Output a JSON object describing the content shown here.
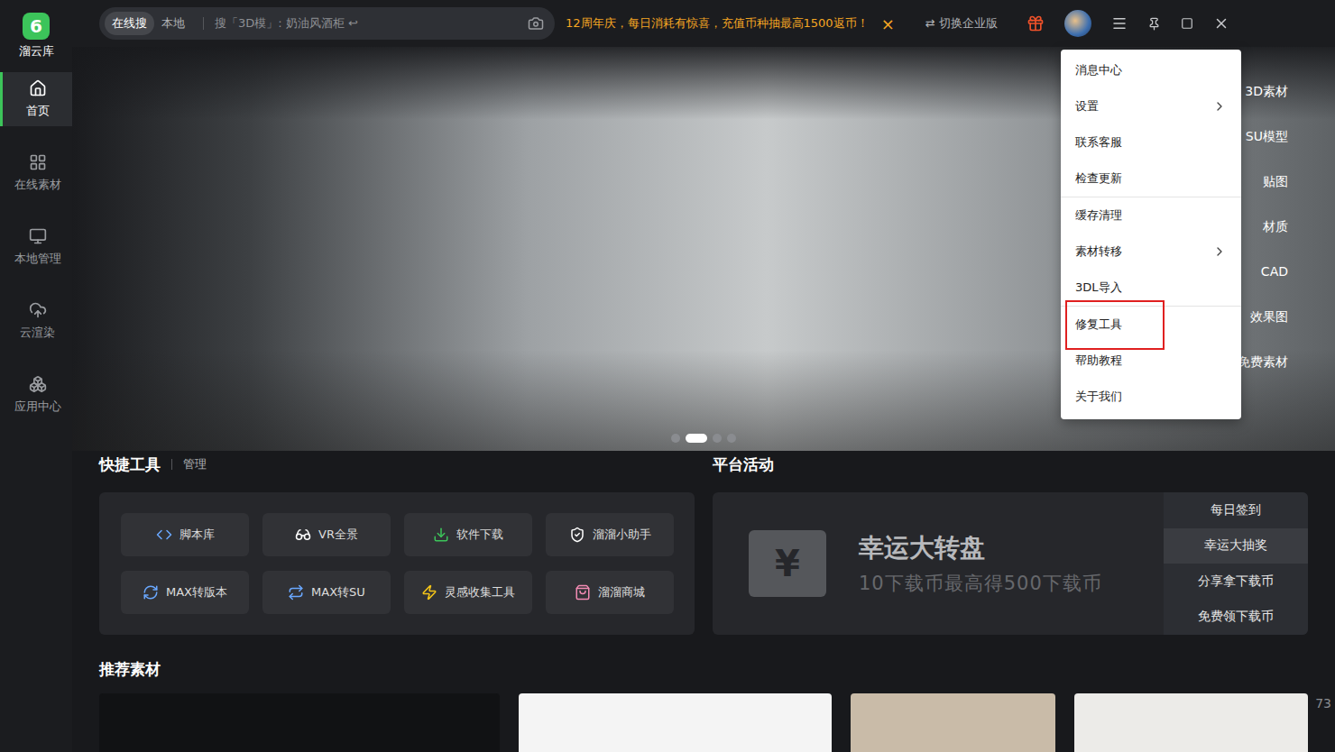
{
  "app": {
    "logo_glyph": "6",
    "name": "溜云库"
  },
  "sidebar": {
    "items": [
      {
        "label": "首页",
        "selected": true
      },
      {
        "label": "在线素材",
        "selected": false
      },
      {
        "label": "本地管理",
        "selected": false
      },
      {
        "label": "云渲染",
        "selected": false
      },
      {
        "label": "应用中心",
        "selected": false
      }
    ]
  },
  "search": {
    "tabs": [
      {
        "label": "在线搜",
        "selected": true
      },
      {
        "label": "本地",
        "selected": false
      }
    ],
    "placeholder": "搜「3D模」: 奶油风酒柜",
    "enter_glyph": "↩"
  },
  "promo": {
    "text": "12周年庆，每日消耗有惊喜，充值币种抽最高1500返币！",
    "close": "×"
  },
  "switch_edition": {
    "icon": "⇄",
    "label": "切换企业版"
  },
  "banner": {
    "categories": [
      "3D素材",
      "SU模型",
      "贴图",
      "材质",
      "CAD",
      "效果图",
      "免费素材"
    ],
    "slides": [
      {
        "selected": false
      },
      {
        "selected": true
      },
      {
        "selected": false
      },
      {
        "selected": false
      }
    ]
  },
  "menu": {
    "items": [
      {
        "label": "消息中心",
        "submenu": false,
        "separator_before": false,
        "highlighted": false
      },
      {
        "label": "设置",
        "submenu": true,
        "separator_before": false,
        "highlighted": false
      },
      {
        "label": "联系客服",
        "submenu": false,
        "separator_before": false,
        "highlighted": false
      },
      {
        "label": "检查更新",
        "submenu": false,
        "separator_before": false,
        "highlighted": false
      },
      {
        "label": "缓存清理",
        "submenu": false,
        "separator_before": true,
        "highlighted": false
      },
      {
        "label": "素材转移",
        "submenu": true,
        "separator_before": false,
        "highlighted": false
      },
      {
        "label": "3DL导入",
        "submenu": false,
        "separator_before": false,
        "highlighted": false
      },
      {
        "label": "修复工具",
        "submenu": false,
        "separator_before": true,
        "highlighted": true
      },
      {
        "label": "帮助教程",
        "submenu": false,
        "separator_before": false,
        "highlighted": false
      },
      {
        "label": "关于我们",
        "submenu": false,
        "separator_before": false,
        "highlighted": false
      }
    ]
  },
  "quick_tools": {
    "title": "快捷工具",
    "manage": "管理",
    "items": [
      {
        "label": "脚本库"
      },
      {
        "label": "VR全景"
      },
      {
        "label": "软件下载"
      },
      {
        "label": "溜溜小助手"
      },
      {
        "label": "MAX转版本"
      },
      {
        "label": "MAX转SU"
      },
      {
        "label": "灵感收集工具"
      },
      {
        "label": "溜溜商城"
      }
    ]
  },
  "activities": {
    "title": "平台活动",
    "feature": {
      "ticket_glyph": "¥",
      "title": "幸运大转盘",
      "subtitle": "10下载币最高得500下载币"
    },
    "items": [
      {
        "label": "每日签到",
        "selected": false
      },
      {
        "label": "幸运大抽奖",
        "selected": true
      },
      {
        "label": "分享拿下载币",
        "selected": false
      },
      {
        "label": "免费领下载币",
        "selected": false
      }
    ]
  },
  "recommended": {
    "title": "推荐素材",
    "cards": [
      {
        "color": "#111214"
      },
      {
        "color": "#f4f4f4"
      },
      {
        "color": "#c9bba8"
      },
      {
        "color": "#ecebe8"
      }
    ]
  },
  "page_counter": "73"
}
